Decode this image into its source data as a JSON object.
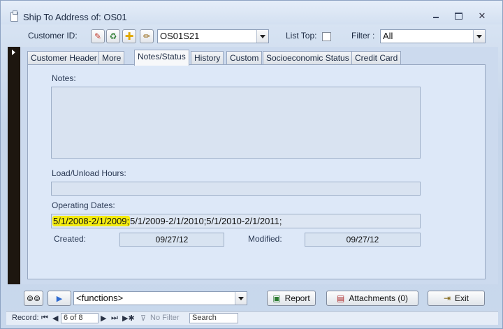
{
  "window": {
    "title": "Ship To Address of: OS01"
  },
  "header": {
    "customer_id_label": "Customer ID:",
    "customer_id_value": "OS01S21",
    "list_top_label": "List Top:",
    "filter_label": "Filter :",
    "filter_value": "All",
    "toolbar_icons": [
      "edit-icon",
      "delete-icon",
      "add-icon",
      "pencil-icon"
    ]
  },
  "tabs": [
    {
      "label": "Customer Header"
    },
    {
      "label": "More"
    },
    {
      "label": "Notes/Status"
    },
    {
      "label": "History"
    },
    {
      "label": "Custom"
    },
    {
      "label": "Socioeconomic Status"
    },
    {
      "label": "Credit Card"
    }
  ],
  "active_tab": "Notes/Status",
  "notes_status": {
    "notes_label": "Notes:",
    "notes_value": "",
    "load_hours_label": "Load/Unload Hours:",
    "load_hours_value": "",
    "operating_dates_label": "Operating Dates:",
    "operating_dates_highlighted": "5/1/2008-2/1/2009;",
    "operating_dates_rest": "5/1/2009-2/1/2010;5/1/2010-2/1/2011;",
    "created_label": "Created:",
    "created_value": "09/27/12",
    "modified_label": "Modified:",
    "modified_value": "09/27/12"
  },
  "commands": {
    "functions_value": "<functions>",
    "report_label": "Report",
    "attachments_label": "Attachments (0)",
    "exit_label": "Exit"
  },
  "record_nav": {
    "record_label": "Record:",
    "position": "6 of 8",
    "no_filter_label": "No Filter",
    "search_placeholder": "Search"
  },
  "colors": {
    "highlight": "#f4ec10",
    "record_selector": "#1d160f",
    "tab_page": "#dde8f8"
  }
}
